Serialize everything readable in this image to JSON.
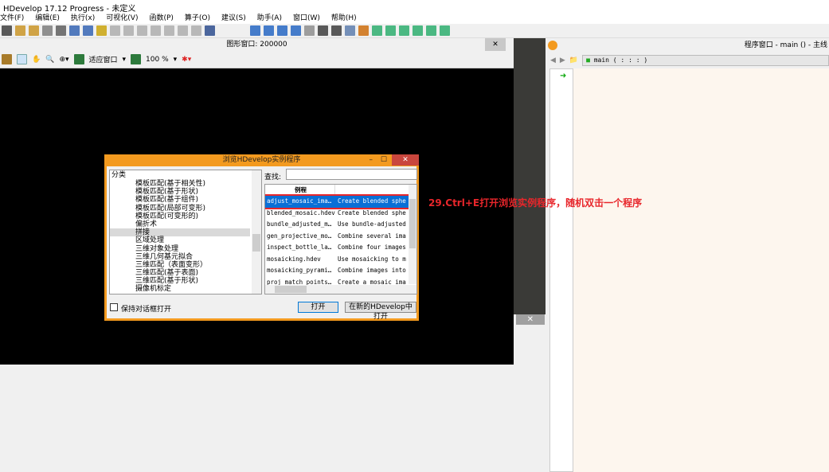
{
  "app": {
    "title": "HDevelop 17.12 Progress - 未定义"
  },
  "menu": [
    "文件(F)",
    "编辑(E)",
    "执行(x)",
    "可视化(V)",
    "函数(P)",
    "算子(O)",
    "建议(S)",
    "助手(A)",
    "窗口(W)",
    "帮助(H)"
  ],
  "graphics_window": {
    "title": "图形窗口: 200000",
    "fit_label": "适应窗口",
    "zoom": "100 %"
  },
  "program_window": {
    "title": "程序窗口 - main () - 主线",
    "procedure": "main ( : : : )"
  },
  "dialog": {
    "title": "浏览HDevelop实例程序",
    "category_header": "分类",
    "categories": [
      "模板匹配(基于相关性)",
      "模板匹配(基于形状)",
      "模板匹配(基于组件)",
      "模板匹配(局部可变形)",
      "模板匹配(可变形的)",
      "偏折术",
      "拼接",
      "区域处理",
      "三维对象处理",
      "三维几何基元拟合",
      "三维匹配（表面变形）",
      "三维匹配(基于表面)",
      "三维匹配(基于形状)",
      "摄像机标定"
    ],
    "selected_category": "拼接",
    "search_label": "查找:",
    "search_value": "",
    "column_header": "例程",
    "rows": [
      [
        "adjust_mosaic_ima…",
        "Create blended spher"
      ],
      [
        "blended_mosaic.hdev",
        "Create blended spher"
      ],
      [
        "bundle_adjusted_m…",
        "Use bundle-adjusted"
      ],
      [
        "gen_projective_mo…",
        "Combine several ima"
      ],
      [
        "inspect_bottle_la…",
        "Combine four images"
      ],
      [
        "mosaicking.hdev",
        "Use mosaicking to m"
      ],
      [
        "mosaicking_pyrami…",
        "Combine images into"
      ],
      [
        "proj_match_points…",
        "Create a mosaic ima"
      ]
    ],
    "keep_open_label": "保持对话框打开",
    "open_label": "打开",
    "open_new_label": "在新的HDevelop中打开"
  },
  "annotation": "29.Ctrl+E打开浏览实例程序，随机双击一个程序",
  "colors": {
    "accent": "#f39a1f",
    "selection": "#0a6fd6",
    "annotation": "#e8262b"
  }
}
